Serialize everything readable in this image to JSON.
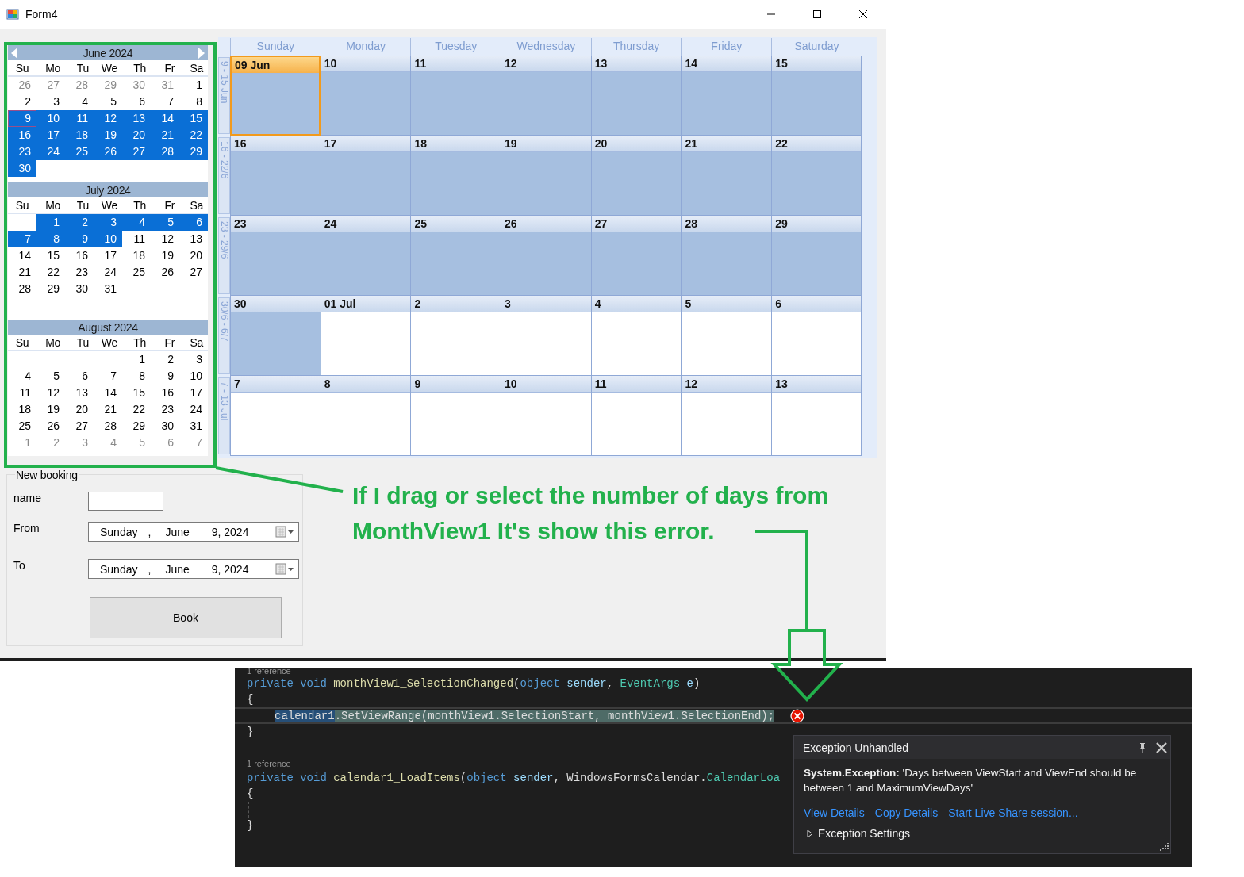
{
  "window": {
    "title": "Form4"
  },
  "month_view": {
    "months": [
      {
        "title": "June 2024",
        "nav_arrows": true,
        "day_names": [
          "Su",
          "Mo",
          "Tu",
          "We",
          "Th",
          "Fr",
          "Sa"
        ],
        "weeks": [
          {
            "days": [
              {
                "d": "26",
                "muted": true,
                "selected": false,
                "today": false
              },
              {
                "d": "27",
                "muted": true,
                "selected": false,
                "today": false
              },
              {
                "d": "28",
                "muted": true,
                "selected": false,
                "today": false
              },
              {
                "d": "29",
                "muted": true,
                "selected": false,
                "today": false
              },
              {
                "d": "30",
                "muted": true,
                "selected": false,
                "today": false
              },
              {
                "d": "31",
                "muted": true,
                "selected": false,
                "today": false
              },
              {
                "d": "1",
                "muted": false,
                "selected": false,
                "today": false
              }
            ]
          },
          {
            "days": [
              {
                "d": "2",
                "muted": false,
                "selected": false,
                "today": false
              },
              {
                "d": "3",
                "muted": false,
                "selected": false,
                "today": false
              },
              {
                "d": "4",
                "muted": false,
                "selected": false,
                "today": false
              },
              {
                "d": "5",
                "muted": false,
                "selected": false,
                "today": false
              },
              {
                "d": "6",
                "muted": false,
                "selected": false,
                "today": false
              },
              {
                "d": "7",
                "muted": false,
                "selected": false,
                "today": false
              },
              {
                "d": "8",
                "muted": false,
                "selected": false,
                "today": false
              }
            ]
          },
          {
            "days": [
              {
                "d": "9",
                "muted": false,
                "selected": true,
                "today": true
              },
              {
                "d": "10",
                "muted": false,
                "selected": true,
                "today": false
              },
              {
                "d": "11",
                "muted": false,
                "selected": true,
                "today": false
              },
              {
                "d": "12",
                "muted": false,
                "selected": true,
                "today": false
              },
              {
                "d": "13",
                "muted": false,
                "selected": true,
                "today": false
              },
              {
                "d": "14",
                "muted": false,
                "selected": true,
                "today": false
              },
              {
                "d": "15",
                "muted": false,
                "selected": true,
                "today": false
              }
            ]
          },
          {
            "days": [
              {
                "d": "16",
                "muted": false,
                "selected": true,
                "today": false
              },
              {
                "d": "17",
                "muted": false,
                "selected": true,
                "today": false
              },
              {
                "d": "18",
                "muted": false,
                "selected": true,
                "today": false
              },
              {
                "d": "19",
                "muted": false,
                "selected": true,
                "today": false
              },
              {
                "d": "20",
                "muted": false,
                "selected": true,
                "today": false
              },
              {
                "d": "21",
                "muted": false,
                "selected": true,
                "today": false
              },
              {
                "d": "22",
                "muted": false,
                "selected": true,
                "today": false
              }
            ]
          },
          {
            "days": [
              {
                "d": "23",
                "muted": false,
                "selected": true,
                "today": false
              },
              {
                "d": "24",
                "muted": false,
                "selected": true,
                "today": false
              },
              {
                "d": "25",
                "muted": false,
                "selected": true,
                "today": false
              },
              {
                "d": "26",
                "muted": false,
                "selected": true,
                "today": false
              },
              {
                "d": "27",
                "muted": false,
                "selected": true,
                "today": false
              },
              {
                "d": "28",
                "muted": false,
                "selected": true,
                "today": false
              },
              {
                "d": "29",
                "muted": false,
                "selected": true,
                "today": false
              }
            ]
          },
          {
            "pad_left": false,
            "days": [
              {
                "d": "30",
                "muted": false,
                "selected": true,
                "today": false
              }
            ]
          }
        ]
      },
      {
        "title": "July 2024",
        "nav_arrows": false,
        "day_names": [
          "Su",
          "Mo",
          "Tu",
          "We",
          "Th",
          "Fr",
          "Sa"
        ],
        "weeks": [
          {
            "pad_left": true,
            "days": [
              {
                "d": "1",
                "muted": false,
                "selected": true,
                "today": false
              },
              {
                "d": "2",
                "muted": false,
                "selected": true,
                "today": false
              },
              {
                "d": "3",
                "muted": false,
                "selected": true,
                "today": false
              },
              {
                "d": "4",
                "muted": false,
                "selected": true,
                "today": false
              },
              {
                "d": "5",
                "muted": false,
                "selected": true,
                "today": false
              },
              {
                "d": "6",
                "muted": false,
                "selected": true,
                "today": false
              }
            ]
          },
          {
            "days": [
              {
                "d": "7",
                "muted": false,
                "selected": true,
                "today": false
              },
              {
                "d": "8",
                "muted": false,
                "selected": true,
                "today": false
              },
              {
                "d": "9",
                "muted": false,
                "selected": true,
                "today": false
              },
              {
                "d": "10",
                "muted": false,
                "selected": true,
                "today": false
              },
              {
                "d": "11",
                "muted": false,
                "selected": false,
                "today": false
              },
              {
                "d": "12",
                "muted": false,
                "selected": false,
                "today": false
              },
              {
                "d": "13",
                "muted": false,
                "selected": false,
                "today": false
              }
            ]
          },
          {
            "days": [
              {
                "d": "14",
                "muted": false,
                "selected": false,
                "today": false
              },
              {
                "d": "15",
                "muted": false,
                "selected": false,
                "today": false
              },
              {
                "d": "16",
                "muted": false,
                "selected": false,
                "today": false
              },
              {
                "d": "17",
                "muted": false,
                "selected": false,
                "today": false
              },
              {
                "d": "18",
                "muted": false,
                "selected": false,
                "today": false
              },
              {
                "d": "19",
                "muted": false,
                "selected": false,
                "today": false
              },
              {
                "d": "20",
                "muted": false,
                "selected": false,
                "today": false
              }
            ]
          },
          {
            "days": [
              {
                "d": "21",
                "muted": false,
                "selected": false,
                "today": false
              },
              {
                "d": "22",
                "muted": false,
                "selected": false,
                "today": false
              },
              {
                "d": "23",
                "muted": false,
                "selected": false,
                "today": false
              },
              {
                "d": "24",
                "muted": false,
                "selected": false,
                "today": false
              },
              {
                "d": "25",
                "muted": false,
                "selected": false,
                "today": false
              },
              {
                "d": "26",
                "muted": false,
                "selected": false,
                "today": false
              },
              {
                "d": "27",
                "muted": false,
                "selected": false,
                "today": false
              }
            ]
          },
          {
            "pad_left": false,
            "days": [
              {
                "d": "28",
                "muted": false,
                "selected": false,
                "today": false
              },
              {
                "d": "29",
                "muted": false,
                "selected": false,
                "today": false
              },
              {
                "d": "30",
                "muted": false,
                "selected": false,
                "today": false
              },
              {
                "d": "31",
                "muted": false,
                "selected": false,
                "today": false
              }
            ]
          }
        ]
      },
      {
        "title": "August 2024",
        "nav_arrows": false,
        "day_names": [
          "Su",
          "Mo",
          "Tu",
          "We",
          "Th",
          "Fr",
          "Sa"
        ],
        "weeks": [
          {
            "pad_left": true,
            "days": [
              {
                "d": "1",
                "muted": false,
                "selected": false,
                "today": false
              },
              {
                "d": "2",
                "muted": false,
                "selected": false,
                "today": false
              },
              {
                "d": "3",
                "muted": false,
                "selected": false,
                "today": false
              }
            ]
          },
          {
            "days": [
              {
                "d": "4",
                "muted": false,
                "selected": false,
                "today": false
              },
              {
                "d": "5",
                "muted": false,
                "selected": false,
                "today": false
              },
              {
                "d": "6",
                "muted": false,
                "selected": false,
                "today": false
              },
              {
                "d": "7",
                "muted": false,
                "selected": false,
                "today": false
              },
              {
                "d": "8",
                "muted": false,
                "selected": false,
                "today": false
              },
              {
                "d": "9",
                "muted": false,
                "selected": false,
                "today": false
              },
              {
                "d": "10",
                "muted": false,
                "selected": false,
                "today": false
              }
            ]
          },
          {
            "days": [
              {
                "d": "11",
                "muted": false,
                "selected": false,
                "today": false
              },
              {
                "d": "12",
                "muted": false,
                "selected": false,
                "today": false
              },
              {
                "d": "13",
                "muted": false,
                "selected": false,
                "today": false
              },
              {
                "d": "14",
                "muted": false,
                "selected": false,
                "today": false
              },
              {
                "d": "15",
                "muted": false,
                "selected": false,
                "today": false
              },
              {
                "d": "16",
                "muted": false,
                "selected": false,
                "today": false
              },
              {
                "d": "17",
                "muted": false,
                "selected": false,
                "today": false
              }
            ]
          },
          {
            "days": [
              {
                "d": "18",
                "muted": false,
                "selected": false,
                "today": false
              },
              {
                "d": "19",
                "muted": false,
                "selected": false,
                "today": false
              },
              {
                "d": "20",
                "muted": false,
                "selected": false,
                "today": false
              },
              {
                "d": "21",
                "muted": false,
                "selected": false,
                "today": false
              },
              {
                "d": "22",
                "muted": false,
                "selected": false,
                "today": false
              },
              {
                "d": "23",
                "muted": false,
                "selected": false,
                "today": false
              },
              {
                "d": "24",
                "muted": false,
                "selected": false,
                "today": false
              }
            ]
          },
          {
            "days": [
              {
                "d": "25",
                "muted": false,
                "selected": false,
                "today": false
              },
              {
                "d": "26",
                "muted": false,
                "selected": false,
                "today": false
              },
              {
                "d": "27",
                "muted": false,
                "selected": false,
                "today": false
              },
              {
                "d": "28",
                "muted": false,
                "selected": false,
                "today": false
              },
              {
                "d": "29",
                "muted": false,
                "selected": false,
                "today": false
              },
              {
                "d": "30",
                "muted": false,
                "selected": false,
                "today": false
              },
              {
                "d": "31",
                "muted": false,
                "selected": false,
                "today": false
              }
            ]
          },
          {
            "days": [
              {
                "d": "1",
                "muted": true,
                "selected": false,
                "today": false
              },
              {
                "d": "2",
                "muted": true,
                "selected": false,
                "today": false
              },
              {
                "d": "3",
                "muted": true,
                "selected": false,
                "today": false
              },
              {
                "d": "4",
                "muted": true,
                "selected": false,
                "today": false
              },
              {
                "d": "5",
                "muted": true,
                "selected": false,
                "today": false
              },
              {
                "d": "6",
                "muted": true,
                "selected": false,
                "today": false
              },
              {
                "d": "7",
                "muted": true,
                "selected": false,
                "today": false
              }
            ]
          }
        ]
      }
    ]
  },
  "calendar": {
    "day_headers": [
      "Sunday",
      "Monday",
      "Tuesday",
      "Wednesday",
      "Thursday",
      "Friday",
      "Saturday"
    ],
    "weeks": [
      {
        "label": "9 - 15 Jun",
        "days": [
          {
            "date": "09 Jun",
            "selected": true,
            "today": true
          },
          {
            "date": "10",
            "selected": true,
            "today": false
          },
          {
            "date": "11",
            "selected": true,
            "today": false
          },
          {
            "date": "12",
            "selected": true,
            "today": false
          },
          {
            "date": "13",
            "selected": true,
            "today": false
          },
          {
            "date": "14",
            "selected": true,
            "today": false
          },
          {
            "date": "15",
            "selected": true,
            "today": false
          }
        ]
      },
      {
        "label": "16 - 22/6",
        "days": [
          {
            "date": "16",
            "selected": true,
            "today": false
          },
          {
            "date": "17",
            "selected": true,
            "today": false
          },
          {
            "date": "18",
            "selected": true,
            "today": false
          },
          {
            "date": "19",
            "selected": true,
            "today": false
          },
          {
            "date": "20",
            "selected": true,
            "today": false
          },
          {
            "date": "21",
            "selected": true,
            "today": false
          },
          {
            "date": "22",
            "selected": true,
            "today": false
          }
        ]
      },
      {
        "label": "23 - 29/6",
        "days": [
          {
            "date": "23",
            "selected": true,
            "today": false
          },
          {
            "date": "24",
            "selected": true,
            "today": false
          },
          {
            "date": "25",
            "selected": true,
            "today": false
          },
          {
            "date": "26",
            "selected": true,
            "today": false
          },
          {
            "date": "27",
            "selected": true,
            "today": false
          },
          {
            "date": "28",
            "selected": true,
            "today": false
          },
          {
            "date": "29",
            "selected": true,
            "today": false
          }
        ]
      },
      {
        "label": "30/6 - 6/7",
        "days": [
          {
            "date": "30",
            "selected": true,
            "today": false
          },
          {
            "date": "01 Jul",
            "selected": false,
            "today": false
          },
          {
            "date": "2",
            "selected": false,
            "today": false
          },
          {
            "date": "3",
            "selected": false,
            "today": false
          },
          {
            "date": "4",
            "selected": false,
            "today": false
          },
          {
            "date": "5",
            "selected": false,
            "today": false
          },
          {
            "date": "6",
            "selected": false,
            "today": false
          }
        ]
      },
      {
        "label": "7 - 13 Jul",
        "days": [
          {
            "date": "7",
            "selected": false,
            "today": false
          },
          {
            "date": "8",
            "selected": false,
            "today": false
          },
          {
            "date": "9",
            "selected": false,
            "today": false
          },
          {
            "date": "10",
            "selected": false,
            "today": false
          },
          {
            "date": "11",
            "selected": false,
            "today": false
          },
          {
            "date": "12",
            "selected": false,
            "today": false
          },
          {
            "date": "13",
            "selected": false,
            "today": false
          }
        ]
      }
    ]
  },
  "booking": {
    "title": "New booking",
    "name_label": "name",
    "dates": [
      {
        "label": "From",
        "weekday": "Sunday",
        "separator": ",",
        "month": "June",
        "day_year": "9, 2024"
      },
      {
        "label": "To",
        "weekday": "Sunday",
        "separator": ",",
        "month": "June",
        "day_year": "9, 2024"
      }
    ],
    "button": "Book"
  },
  "annotation": {
    "text": "If I drag or select the number of days from MonthView1 It's show this error."
  },
  "code": {
    "blocks": [
      {
        "reference": "1 reference",
        "lines": [
          {
            "kind": "code",
            "indented": false,
            "current": false,
            "tokens": [
              {
                "t": "private void ",
                "kind": "keyword"
              },
              {
                "t": "monthView1_SelectionChanged",
                "kind": "method"
              },
              {
                "t": "(",
                "kind": "text"
              },
              {
                "t": "object ",
                "kind": "keyword"
              },
              {
                "t": "sender",
                "kind": "param"
              },
              {
                "t": ", ",
                "kind": "text"
              },
              {
                "t": "EventArgs ",
                "kind": "type"
              },
              {
                "t": "e",
                "kind": "param"
              },
              {
                "t": ")",
                "kind": "text"
              }
            ]
          },
          {
            "kind": "code",
            "indented": false,
            "current": false,
            "tokens": [
              {
                "t": "{",
                "kind": "text"
              }
            ]
          },
          {
            "kind": "code",
            "indented": true,
            "current": true,
            "tokens": [
              {
                "t": "calendar1",
                "kind": "selection"
              },
              {
                "t": ".SetViewRange(monthView1.SelectionStart, monthView1.SelectionEnd);",
                "kind": "text"
              }
            ]
          },
          {
            "kind": "code",
            "indented": false,
            "current": false,
            "tokens": [
              {
                "t": "}",
                "kind": "text"
              }
            ]
          }
        ]
      },
      {
        "reference": "1 reference",
        "lines": [
          {
            "kind": "code",
            "indented": false,
            "current": false,
            "tokens": [
              {
                "t": "private void ",
                "kind": "keyword"
              },
              {
                "t": "calendar1_LoadItems",
                "kind": "method"
              },
              {
                "t": "(",
                "kind": "text"
              },
              {
                "t": "object ",
                "kind": "keyword"
              },
              {
                "t": "sender",
                "kind": "param"
              },
              {
                "t": ", WindowsFormsCalendar.",
                "kind": "text"
              },
              {
                "t": "CalendarLoa",
                "kind": "type"
              }
            ]
          },
          {
            "kind": "code",
            "indented": false,
            "current": false,
            "tokens": [
              {
                "t": "{",
                "kind": "text"
              }
            ]
          },
          {
            "kind": "blank"
          },
          {
            "kind": "code",
            "indented": false,
            "current": false,
            "tokens": [
              {
                "t": "}",
                "kind": "text"
              }
            ]
          }
        ]
      }
    ]
  },
  "exception": {
    "title": "Exception Unhandled",
    "message": "**System.Exception:** 'Days between ViewStart and ViewEnd should be between 1 and MaximumViewDays'",
    "links": [
      "View Details",
      "Copy Details",
      "Start Live Share session..."
    ],
    "settings": {
      "label": "Exception Settings",
      "expanded": false
    }
  }
}
